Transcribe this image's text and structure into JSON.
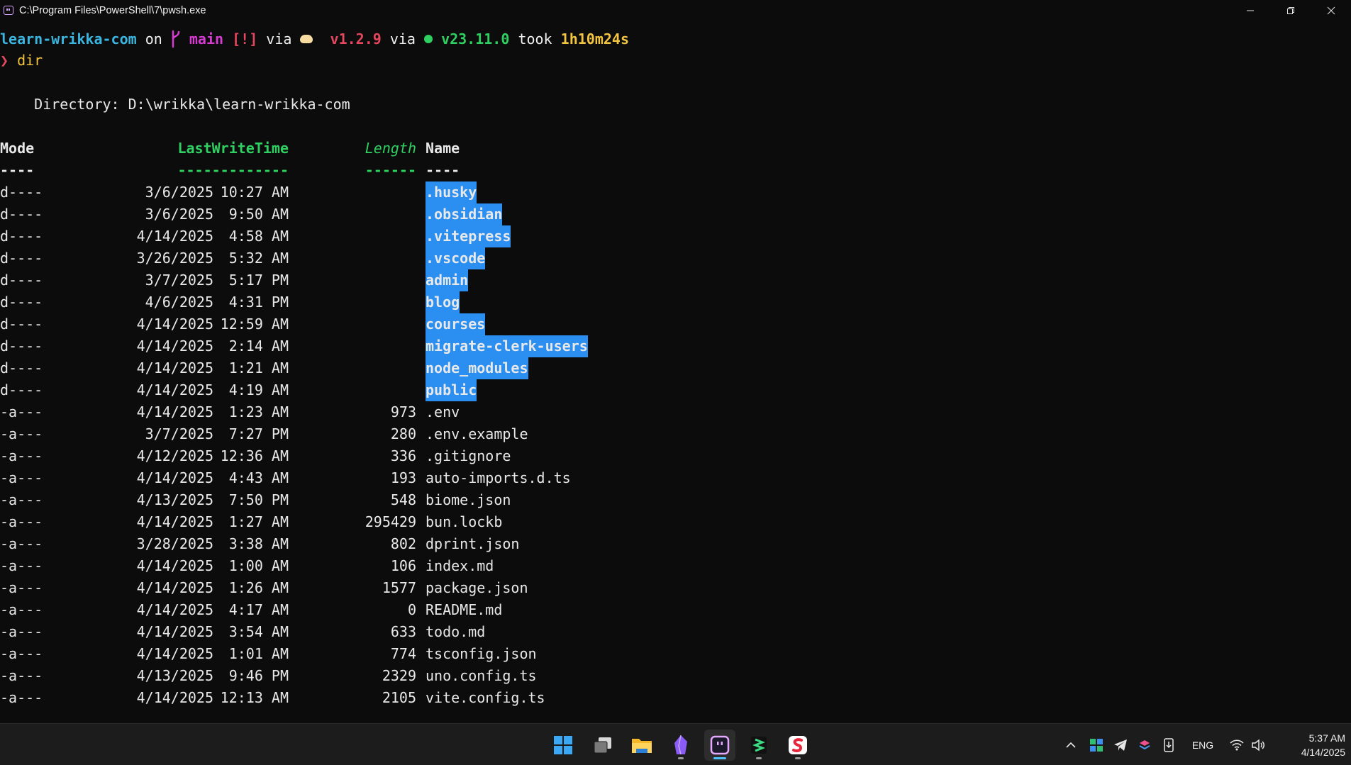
{
  "window": {
    "title": "C:\\Program Files\\PowerShell\\7\\pwsh.exe"
  },
  "prompt": {
    "dir": "learn-wrikka-com",
    "on": "on",
    "branch": "main",
    "status": "[!]",
    "via1": "via",
    "bun_version": "v1.2.9",
    "via2": "via",
    "node_version": "v23.11.0",
    "took": "took",
    "duration": "1h10m24s",
    "symbol": "❯",
    "command": "dir"
  },
  "listing": {
    "directory_line": "    Directory: D:\\wrikka\\learn-wrikka-com",
    "headers": {
      "mode": "Mode",
      "lastwrite": "LastWriteTime",
      "length": "Length",
      "name": "Name"
    },
    "underlines": {
      "mode": "----",
      "lastwrite": "-------------",
      "length": "------",
      "name": "----"
    },
    "rows": [
      {
        "mode": "d----",
        "date": "3/6/2025",
        "time": "10:27 AM",
        "length": "",
        "name": ".husky",
        "selected": true
      },
      {
        "mode": "d----",
        "date": "3/6/2025",
        "time": "9:50 AM",
        "length": "",
        "name": ".obsidian",
        "selected": true
      },
      {
        "mode": "d----",
        "date": "4/14/2025",
        "time": "4:58 AM",
        "length": "",
        "name": ".vitepress",
        "selected": true
      },
      {
        "mode": "d----",
        "date": "3/26/2025",
        "time": "5:32 AM",
        "length": "",
        "name": ".vscode",
        "selected": true
      },
      {
        "mode": "d----",
        "date": "3/7/2025",
        "time": "5:17 PM",
        "length": "",
        "name": "admin",
        "selected": true
      },
      {
        "mode": "d----",
        "date": "4/6/2025",
        "time": "4:31 PM",
        "length": "",
        "name": "blog",
        "selected": true
      },
      {
        "mode": "d----",
        "date": "4/14/2025",
        "time": "12:59 AM",
        "length": "",
        "name": "courses",
        "selected": true
      },
      {
        "mode": "d----",
        "date": "4/14/2025",
        "time": "2:14 AM",
        "length": "",
        "name": "migrate-clerk-users",
        "selected": true
      },
      {
        "mode": "d----",
        "date": "4/14/2025",
        "time": "1:21 AM",
        "length": "",
        "name": "node_modules",
        "selected": true
      },
      {
        "mode": "d----",
        "date": "4/14/2025",
        "time": "4:19 AM",
        "length": "",
        "name": "public",
        "selected": true
      },
      {
        "mode": "-a---",
        "date": "4/14/2025",
        "time": "1:23 AM",
        "length": "973",
        "name": ".env",
        "selected": false
      },
      {
        "mode": "-a---",
        "date": "3/7/2025",
        "time": "7:27 PM",
        "length": "280",
        "name": ".env.example",
        "selected": false
      },
      {
        "mode": "-a---",
        "date": "4/12/2025",
        "time": "12:36 AM",
        "length": "336",
        "name": ".gitignore",
        "selected": false
      },
      {
        "mode": "-a---",
        "date": "4/14/2025",
        "time": "4:43 AM",
        "length": "193",
        "name": "auto-imports.d.ts",
        "selected": false
      },
      {
        "mode": "-a---",
        "date": "4/13/2025",
        "time": "7:50 PM",
        "length": "548",
        "name": "biome.json",
        "selected": false
      },
      {
        "mode": "-a---",
        "date": "4/14/2025",
        "time": "1:27 AM",
        "length": "295429",
        "name": "bun.lockb",
        "selected": false
      },
      {
        "mode": "-a---",
        "date": "3/28/2025",
        "time": "3:38 AM",
        "length": "802",
        "name": "dprint.json",
        "selected": false
      },
      {
        "mode": "-a---",
        "date": "4/14/2025",
        "time": "1:00 AM",
        "length": "106",
        "name": "index.md",
        "selected": false
      },
      {
        "mode": "-a---",
        "date": "4/14/2025",
        "time": "1:26 AM",
        "length": "1577",
        "name": "package.json",
        "selected": false
      },
      {
        "mode": "-a---",
        "date": "4/14/2025",
        "time": "4:17 AM",
        "length": "0",
        "name": "README.md",
        "selected": false
      },
      {
        "mode": "-a---",
        "date": "4/14/2025",
        "time": "3:54 AM",
        "length": "633",
        "name": "todo.md",
        "selected": false
      },
      {
        "mode": "-a---",
        "date": "4/14/2025",
        "time": "1:01 AM",
        "length": "774",
        "name": "tsconfig.json",
        "selected": false
      },
      {
        "mode": "-a---",
        "date": "4/13/2025",
        "time": "9:46 PM",
        "length": "2329",
        "name": "uno.config.ts",
        "selected": false
      },
      {
        "mode": "-a---",
        "date": "4/14/2025",
        "time": "12:13 AM",
        "length": "2105",
        "name": "vite.config.ts",
        "selected": false
      }
    ]
  },
  "taskbar": {
    "apps": [
      {
        "name": "start-button",
        "icon": "windows-logo-icon"
      },
      {
        "name": "task-view",
        "icon": "task-view-icon"
      },
      {
        "name": "file-explorer",
        "icon": "folder-icon"
      },
      {
        "name": "obsidian",
        "icon": "obsidian-icon"
      },
      {
        "name": "terminal",
        "icon": "terminal-icon"
      },
      {
        "name": "app-green",
        "icon": "green-app-icon"
      },
      {
        "name": "app-red",
        "icon": "red-app-icon"
      }
    ],
    "tray": {
      "language": "ENG",
      "time": "5:37 AM",
      "date": "4/14/2025"
    }
  },
  "colors": {
    "background": "#0c0c0c",
    "selection": "#2a8ff0",
    "accent_green": "#2fd061",
    "accent_cyan": "#3ab6e0",
    "accent_magenta": "#d63bd1",
    "accent_red": "#e5475f",
    "accent_yellow": "#f2c441"
  }
}
